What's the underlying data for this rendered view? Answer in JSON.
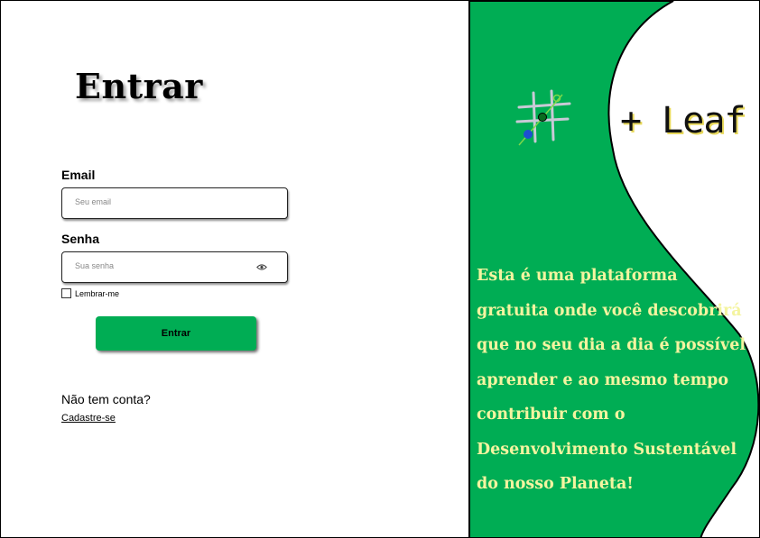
{
  "login": {
    "title": "Entrar",
    "email_label": "Email",
    "email_placeholder": "Seu email",
    "password_label": "Senha",
    "password_placeholder": "Sua senha",
    "remember_label": "Lembrar-me",
    "submit_label": "Entrar",
    "no_account_text": "Não tem conta?",
    "signup_link": "Cadastre-se"
  },
  "side": {
    "brand": "+ Leaf",
    "tagline": "Esta é uma plataforma gratuita onde você descobrirá que no seu dia a dia é possível aprender e ao mesmo tempo contribuir com o Desenvolvimento Sustentável do nosso Planeta!",
    "icons": {
      "logo": "tic-tac-toe-grid-icon",
      "password_toggle": "eye-icon"
    }
  },
  "colors": {
    "panel_green": "#00ad54",
    "tagline_text": "#f4f4a0",
    "brand_shadow": "#e8d95c",
    "button_green": "#00ad54"
  }
}
